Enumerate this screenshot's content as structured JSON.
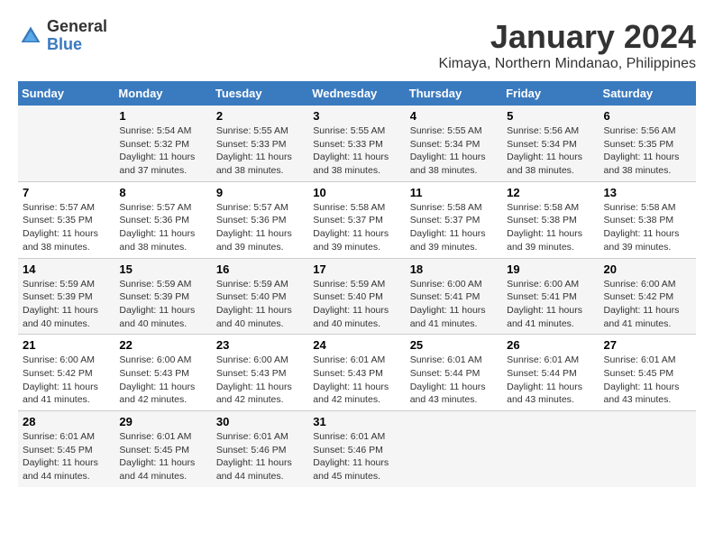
{
  "header": {
    "logo": {
      "general": "General",
      "blue": "Blue"
    },
    "title": "January 2024",
    "location": "Kimaya, Northern Mindanao, Philippines"
  },
  "weekdays": [
    "Sunday",
    "Monday",
    "Tuesday",
    "Wednesday",
    "Thursday",
    "Friday",
    "Saturday"
  ],
  "weeks": [
    [
      {
        "day": "",
        "details": ""
      },
      {
        "day": "1",
        "details": "Sunrise: 5:54 AM\nSunset: 5:32 PM\nDaylight: 11 hours and 37 minutes."
      },
      {
        "day": "2",
        "details": "Sunrise: 5:55 AM\nSunset: 5:33 PM\nDaylight: 11 hours and 38 minutes."
      },
      {
        "day": "3",
        "details": "Sunrise: 5:55 AM\nSunset: 5:33 PM\nDaylight: 11 hours and 38 minutes."
      },
      {
        "day": "4",
        "details": "Sunrise: 5:55 AM\nSunset: 5:34 PM\nDaylight: 11 hours and 38 minutes."
      },
      {
        "day": "5",
        "details": "Sunrise: 5:56 AM\nSunset: 5:34 PM\nDaylight: 11 hours and 38 minutes."
      },
      {
        "day": "6",
        "details": "Sunrise: 5:56 AM\nSunset: 5:35 PM\nDaylight: 11 hours and 38 minutes."
      }
    ],
    [
      {
        "day": "7",
        "details": "Sunrise: 5:57 AM\nSunset: 5:35 PM\nDaylight: 11 hours and 38 minutes."
      },
      {
        "day": "8",
        "details": "Sunrise: 5:57 AM\nSunset: 5:36 PM\nDaylight: 11 hours and 38 minutes."
      },
      {
        "day": "9",
        "details": "Sunrise: 5:57 AM\nSunset: 5:36 PM\nDaylight: 11 hours and 39 minutes."
      },
      {
        "day": "10",
        "details": "Sunrise: 5:58 AM\nSunset: 5:37 PM\nDaylight: 11 hours and 39 minutes."
      },
      {
        "day": "11",
        "details": "Sunrise: 5:58 AM\nSunset: 5:37 PM\nDaylight: 11 hours and 39 minutes."
      },
      {
        "day": "12",
        "details": "Sunrise: 5:58 AM\nSunset: 5:38 PM\nDaylight: 11 hours and 39 minutes."
      },
      {
        "day": "13",
        "details": "Sunrise: 5:58 AM\nSunset: 5:38 PM\nDaylight: 11 hours and 39 minutes."
      }
    ],
    [
      {
        "day": "14",
        "details": "Sunrise: 5:59 AM\nSunset: 5:39 PM\nDaylight: 11 hours and 40 minutes."
      },
      {
        "day": "15",
        "details": "Sunrise: 5:59 AM\nSunset: 5:39 PM\nDaylight: 11 hours and 40 minutes."
      },
      {
        "day": "16",
        "details": "Sunrise: 5:59 AM\nSunset: 5:40 PM\nDaylight: 11 hours and 40 minutes."
      },
      {
        "day": "17",
        "details": "Sunrise: 5:59 AM\nSunset: 5:40 PM\nDaylight: 11 hours and 40 minutes."
      },
      {
        "day": "18",
        "details": "Sunrise: 6:00 AM\nSunset: 5:41 PM\nDaylight: 11 hours and 41 minutes."
      },
      {
        "day": "19",
        "details": "Sunrise: 6:00 AM\nSunset: 5:41 PM\nDaylight: 11 hours and 41 minutes."
      },
      {
        "day": "20",
        "details": "Sunrise: 6:00 AM\nSunset: 5:42 PM\nDaylight: 11 hours and 41 minutes."
      }
    ],
    [
      {
        "day": "21",
        "details": "Sunrise: 6:00 AM\nSunset: 5:42 PM\nDaylight: 11 hours and 41 minutes."
      },
      {
        "day": "22",
        "details": "Sunrise: 6:00 AM\nSunset: 5:43 PM\nDaylight: 11 hours and 42 minutes."
      },
      {
        "day": "23",
        "details": "Sunrise: 6:00 AM\nSunset: 5:43 PM\nDaylight: 11 hours and 42 minutes."
      },
      {
        "day": "24",
        "details": "Sunrise: 6:01 AM\nSunset: 5:43 PM\nDaylight: 11 hours and 42 minutes."
      },
      {
        "day": "25",
        "details": "Sunrise: 6:01 AM\nSunset: 5:44 PM\nDaylight: 11 hours and 43 minutes."
      },
      {
        "day": "26",
        "details": "Sunrise: 6:01 AM\nSunset: 5:44 PM\nDaylight: 11 hours and 43 minutes."
      },
      {
        "day": "27",
        "details": "Sunrise: 6:01 AM\nSunset: 5:45 PM\nDaylight: 11 hours and 43 minutes."
      }
    ],
    [
      {
        "day": "28",
        "details": "Sunrise: 6:01 AM\nSunset: 5:45 PM\nDaylight: 11 hours and 44 minutes."
      },
      {
        "day": "29",
        "details": "Sunrise: 6:01 AM\nSunset: 5:45 PM\nDaylight: 11 hours and 44 minutes."
      },
      {
        "day": "30",
        "details": "Sunrise: 6:01 AM\nSunset: 5:46 PM\nDaylight: 11 hours and 44 minutes."
      },
      {
        "day": "31",
        "details": "Sunrise: 6:01 AM\nSunset: 5:46 PM\nDaylight: 11 hours and 45 minutes."
      },
      {
        "day": "",
        "details": ""
      },
      {
        "day": "",
        "details": ""
      },
      {
        "day": "",
        "details": ""
      }
    ]
  ]
}
